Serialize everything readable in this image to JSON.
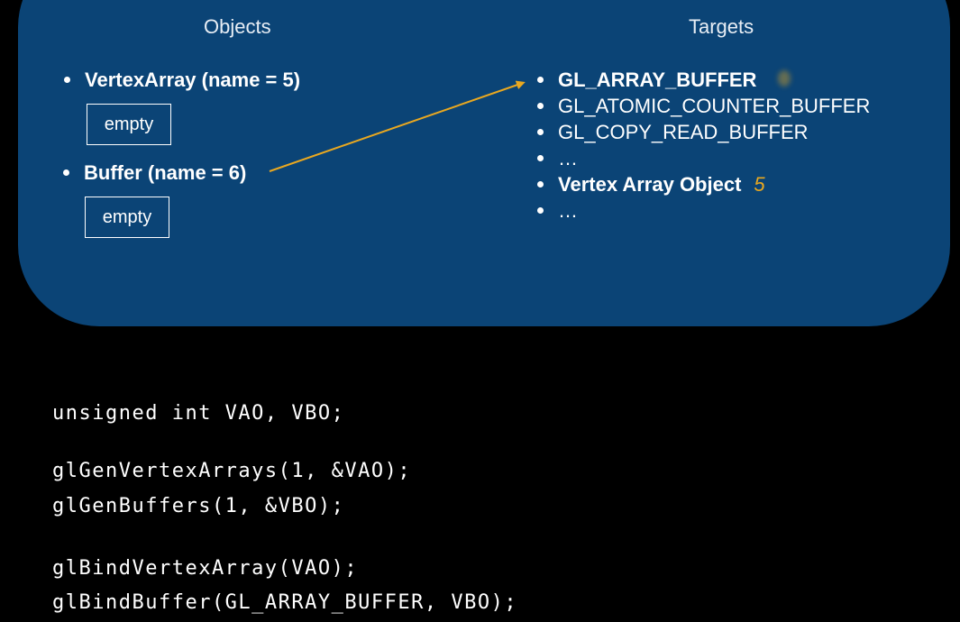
{
  "panel": {
    "objects_title": "Objects",
    "targets_title": "Targets",
    "objects": [
      {
        "label": "VertexArray (name = 5)",
        "box": "empty"
      },
      {
        "label": "Buffer (name = 6)",
        "box": "empty"
      }
    ],
    "targets": [
      {
        "label": "GL_ARRAY_BUFFER",
        "bold": true
      },
      {
        "label": "GL_ATOMIC_COUNTER_BUFFER",
        "bold": false
      },
      {
        "label": "GL_COPY_READ_BUFFER",
        "bold": false
      },
      {
        "label": "…",
        "bold": false
      },
      {
        "label": "Vertex Array Object",
        "bold": true,
        "value": "5"
      },
      {
        "label": "…",
        "bold": false
      }
    ]
  },
  "code_lines": [
    "unsigned int VAO, VBO;",
    "glGenVertexArrays(1, &VAO);",
    "glGenBuffers(1, &VBO);",
    "glBindVertexArray(VAO);",
    "glBindBuffer(GL_ARRAY_BUFFER, VBO);"
  ],
  "colors": {
    "panel": "#0b4476",
    "arrow": "#e9a820",
    "highlight": "#e9a820",
    "background": "#000000"
  },
  "icons": {
    "arrow": "arrow-buffer-to-array-buffer"
  }
}
